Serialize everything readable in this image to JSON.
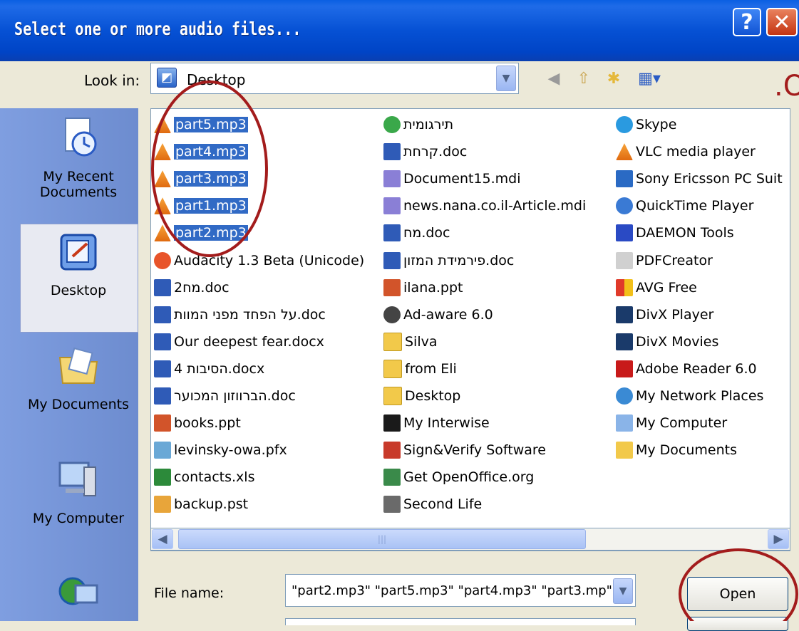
{
  "window": {
    "title": "Select one or more audio files...",
    "help_label": "?",
    "close_label": "✕"
  },
  "lookin": {
    "label": "Look in:",
    "value": "Desktop"
  },
  "overlay_text": ".O",
  "places": {
    "recent_line1": "My Recent",
    "recent_line2": "Documents",
    "desktop": "Desktop",
    "my_documents": "My Documents",
    "my_computer": "My Computer"
  },
  "files": {
    "col1": [
      {
        "name": "part5.mp3",
        "icon": "vlc-cone-icon",
        "selected": true
      },
      {
        "name": "part4.mp3",
        "icon": "vlc-cone-icon",
        "selected": true
      },
      {
        "name": "part3.mp3",
        "icon": "vlc-cone-icon",
        "selected": true
      },
      {
        "name": "part1.mp3",
        "icon": "vlc-cone-icon",
        "selected": true
      },
      {
        "name": "part2.mp3",
        "icon": "vlc-cone-icon",
        "selected": true
      },
      {
        "name": "Audacity 1.3 Beta (Unicode)",
        "icon": "audacity-icon",
        "selected": false
      },
      {
        "name": "2מח.doc",
        "icon": "word-doc-icon",
        "selected": false
      },
      {
        "name": "על הפחד מפני המוות.doc",
        "icon": "word-doc-icon",
        "selected": false
      },
      {
        "name": "Our deepest fear.docx",
        "icon": "word-doc-icon",
        "selected": false
      },
      {
        "name": "הסיבות 4.docx",
        "icon": "word-doc-icon",
        "selected": false
      },
      {
        "name": "הברווזון המכוער.doc",
        "icon": "word-doc-icon",
        "selected": false
      },
      {
        "name": "books.ppt",
        "icon": "powerpoint-icon",
        "selected": false
      },
      {
        "name": "levinsky-owa.pfx",
        "icon": "certificate-icon",
        "selected": false
      },
      {
        "name": "contacts.xls",
        "icon": "excel-icon",
        "selected": false
      },
      {
        "name": "backup.pst",
        "icon": "outlook-pst-icon",
        "selected": false
      }
    ],
    "col2": [
      {
        "name": "תירגומית",
        "icon": "translator-icon"
      },
      {
        "name": "קרחת.doc",
        "icon": "word-doc-icon"
      },
      {
        "name": "Document15.mdi",
        "icon": "mdi-icon"
      },
      {
        "name": "news.nana.co.il-Article.mdi",
        "icon": "mdi-icon"
      },
      {
        "name": "מח.doc",
        "icon": "word-doc-icon"
      },
      {
        "name": "פירמידת המזון.doc",
        "icon": "word-doc-icon"
      },
      {
        "name": "ilana.ppt",
        "icon": "powerpoint-icon"
      },
      {
        "name": "Ad-aware 6.0",
        "icon": "adaware-icon"
      },
      {
        "name": "Silva",
        "icon": "folder-icon"
      },
      {
        "name": "from Eli",
        "icon": "folder-icon"
      },
      {
        "name": "Desktop",
        "icon": "folder-icon"
      },
      {
        "name": "My Interwise",
        "icon": "interwise-icon"
      },
      {
        "name": "Sign&Verify Software",
        "icon": "signverify-icon"
      },
      {
        "name": "Get OpenOffice.org",
        "icon": "openoffice-icon"
      },
      {
        "name": "Second Life",
        "icon": "second-life-icon"
      }
    ],
    "col3": [
      {
        "name": "Skype",
        "icon": "skype-icon"
      },
      {
        "name": "VLC media player",
        "icon": "vlc-cone-icon"
      },
      {
        "name": "Sony Ericsson PC Suit",
        "icon": "sony-ericsson-icon"
      },
      {
        "name": "QuickTime Player",
        "icon": "quicktime-icon"
      },
      {
        "name": "DAEMON Tools",
        "icon": "daemon-tools-icon"
      },
      {
        "name": "PDFCreator",
        "icon": "pdfcreator-icon"
      },
      {
        "name": "AVG Free",
        "icon": "avg-icon"
      },
      {
        "name": "DivX Player",
        "icon": "divx-icon"
      },
      {
        "name": "DivX Movies",
        "icon": "divx-icon"
      },
      {
        "name": "Adobe Reader 6.0",
        "icon": "adobe-reader-icon"
      },
      {
        "name": "My Network Places",
        "icon": "network-places-icon"
      },
      {
        "name": "My Computer",
        "icon": "computer-icon"
      },
      {
        "name": "My Documents",
        "icon": "my-documents-icon"
      }
    ]
  },
  "filename": {
    "label": "File name:",
    "value": "\"part2.mp3\" \"part5.mp3\" \"part4.mp3\" \"part3.mp\""
  },
  "open_label": "Open",
  "colors": {
    "titlebar": "#0651d4",
    "selection": "#316ac5",
    "annotation": "#a31c1c"
  }
}
